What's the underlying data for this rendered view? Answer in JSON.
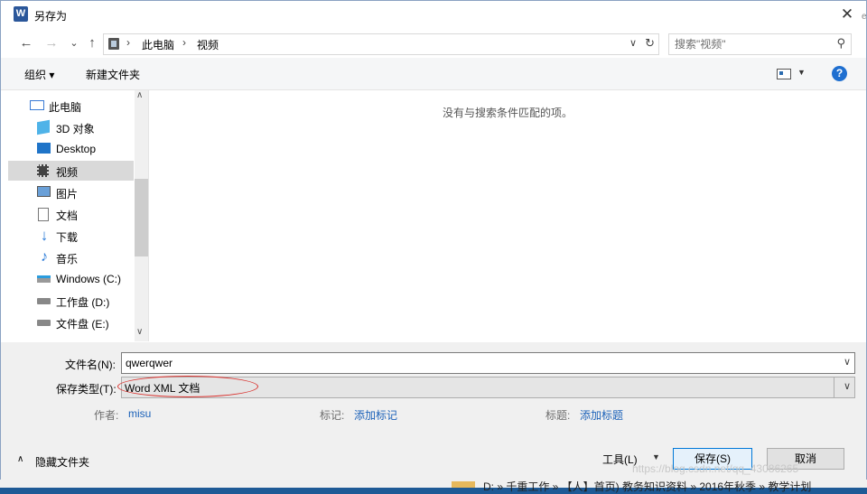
{
  "window": {
    "app_icon": "W",
    "title": "另存为",
    "close": "✕"
  },
  "nav": {
    "back": "←",
    "forward": "→",
    "recent": "⌄",
    "up": "↑",
    "breadcrumb": [
      "此电脑",
      "视频"
    ],
    "separator": "›",
    "search_placeholder": "搜索\"视频\""
  },
  "toolbar": {
    "organize": "组织 ▾",
    "new_folder": "新建文件夹",
    "help": "?"
  },
  "sidebar": {
    "items": [
      {
        "label": "此电脑",
        "icon": "computer-icon",
        "selected": false
      },
      {
        "label": "3D 对象",
        "icon": "cube-3d-icon",
        "selected": false
      },
      {
        "label": "Desktop",
        "icon": "desktop-icon",
        "selected": false
      },
      {
        "label": "视频",
        "icon": "video-icon",
        "selected": true
      },
      {
        "label": "图片",
        "icon": "picture-icon",
        "selected": false
      },
      {
        "label": "文档",
        "icon": "document-icon",
        "selected": false
      },
      {
        "label": "下载",
        "icon": "download-icon",
        "selected": false
      },
      {
        "label": "音乐",
        "icon": "music-icon",
        "selected": false
      },
      {
        "label": "Windows  (C:)",
        "icon": "windows-drive-icon",
        "selected": false
      },
      {
        "label": "工作盘 (D:)",
        "icon": "drive-icon",
        "selected": false
      },
      {
        "label": "文件盘 (E:)",
        "icon": "drive-icon",
        "selected": false
      }
    ]
  },
  "content": {
    "empty_message": "没有与搜索条件匹配的项。"
  },
  "form": {
    "filename_label": "文件名(N):",
    "filename_value": "qwerqwer",
    "filetype_label": "保存类型(T):",
    "filetype_value": "Word XML 文档",
    "author_label": "作者:",
    "author_value": "misu",
    "tags_label": "标记:",
    "tags_value": "添加标记",
    "title_label": "标题:",
    "title_value": "添加标题"
  },
  "footer": {
    "hide_folders": "隐藏文件夹",
    "tools": "工具(L)",
    "save": "保存(S)",
    "cancel": "取消"
  },
  "background": {
    "path_text": "D: » 千重工作 » 【人】首页) 教务知识资料 » 2016年秋季 » 教学计划",
    "watermark": "https://blog.csdn.net/qq_43086265"
  },
  "colors": {
    "accent": "#0078d7",
    "link": "#1c62b9",
    "annotation": "#d9302c",
    "desktop_bg": "#1e5a96"
  }
}
